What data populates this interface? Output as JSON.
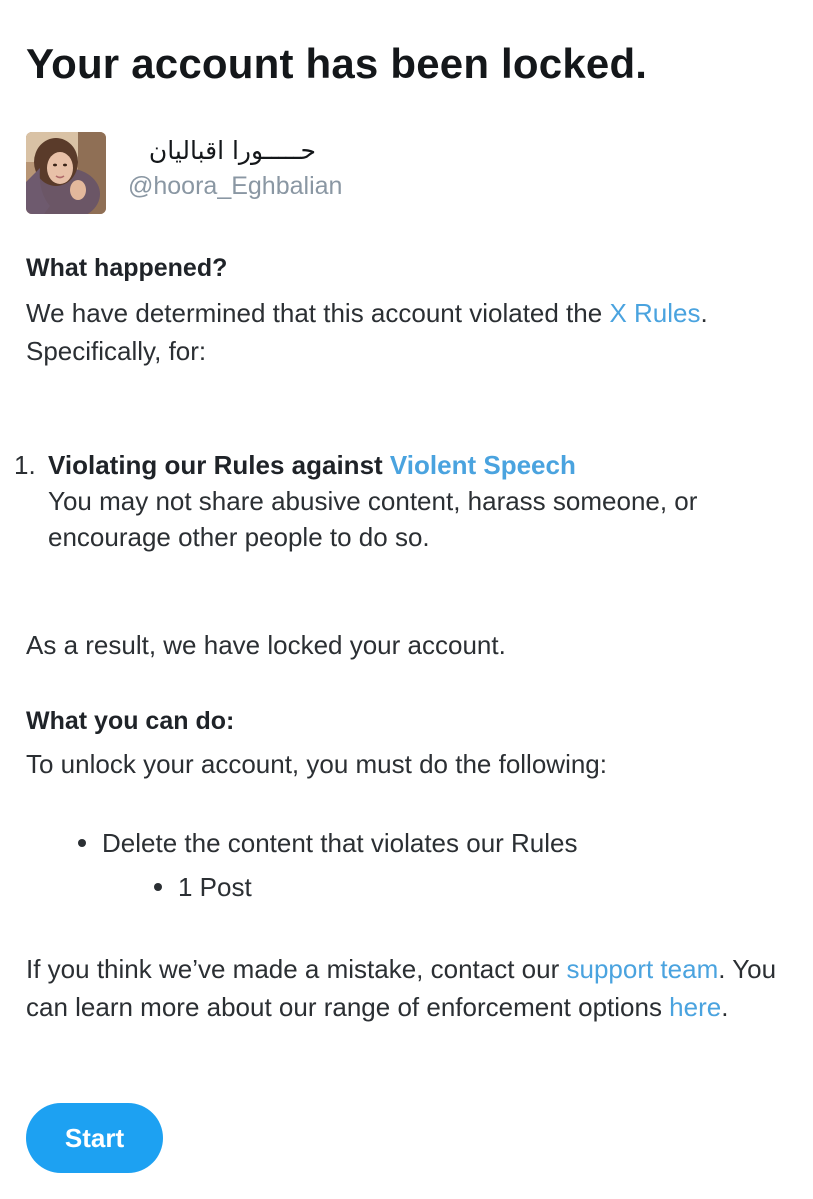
{
  "title": "Your account has been locked.",
  "profile": {
    "display_name": "حـــــورا اقبالیان",
    "handle": "@hoora_Eghbalian"
  },
  "what_happened": {
    "heading": "What happened?",
    "text_before": "We have determined that this account violated the ",
    "rules_link": "X Rules",
    "text_after": ". Specifically, for:"
  },
  "violations": [
    {
      "number": "1.",
      "heading_prefix": "Violating our Rules against ",
      "policy_link": "Violent Speech",
      "description": "You may not share abusive content, harass someone, or encourage other people to do so."
    }
  ],
  "result_text": "As a result, we have locked your account.",
  "what_you_can_do": {
    "heading": "What you can do:",
    "intro": "To unlock your account, you must do the following:",
    "steps": [
      {
        "label": "Delete the content that violates our Rules",
        "sub_items": [
          "1 Post"
        ]
      }
    ]
  },
  "footer": {
    "text_1": "If you think we’ve made a mistake, contact our ",
    "support_link": "support team",
    "text_2": ". You can learn more about our range of enforcement options ",
    "here_link": "here",
    "text_3": "."
  },
  "start_button": "Start",
  "colors": {
    "link": "#4aa3df",
    "button": "#1da1f2",
    "handle": "#8a97a3"
  }
}
